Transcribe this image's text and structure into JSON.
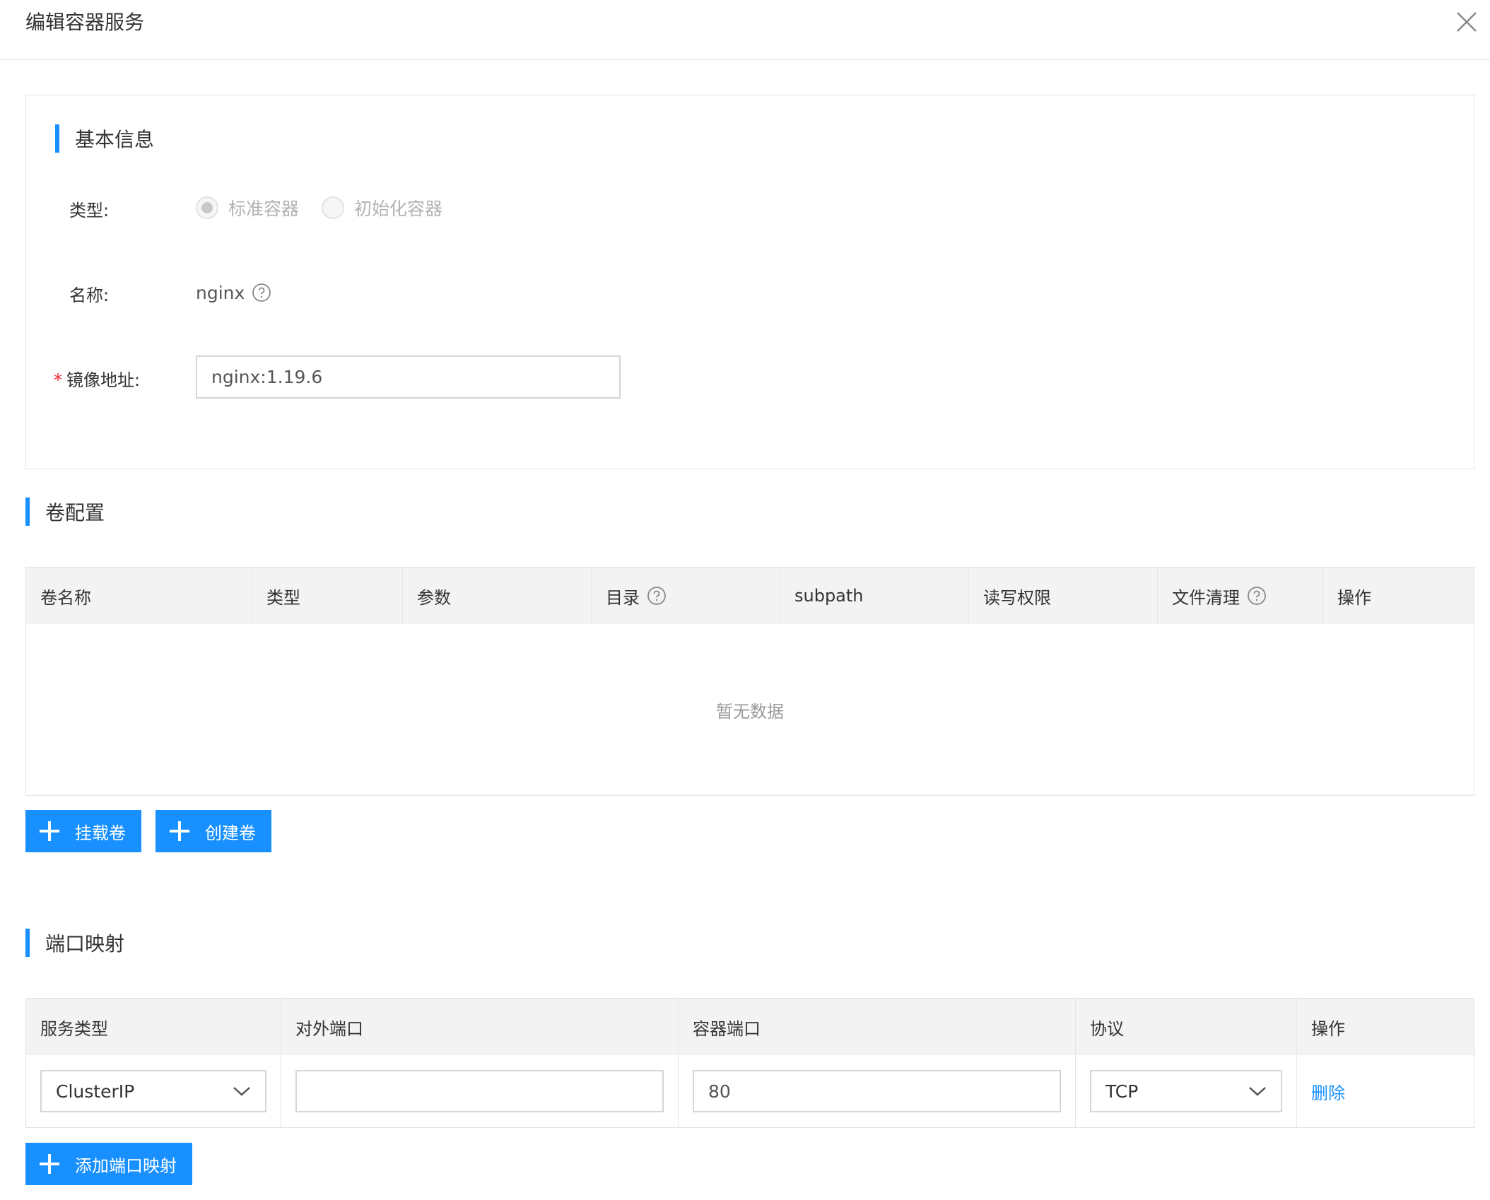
{
  "dialog": {
    "title": "编辑容器服务"
  },
  "basic": {
    "section_title": "基本信息",
    "type_label": "类型:",
    "type_options": [
      "标准容器",
      "初始化容器"
    ],
    "name_label": "名称:",
    "name_value": "nginx",
    "image_label": "镜像地址:",
    "image_value": "nginx:1.19.6"
  },
  "volume": {
    "section_title": "卷配置",
    "columns": [
      "卷名称",
      "类型",
      "参数",
      "目录",
      "subpath",
      "读写权限",
      "文件清理",
      "操作"
    ],
    "empty_text": "暂无数据",
    "mount_button": "挂载卷",
    "create_button": "创建卷"
  },
  "ports": {
    "section_title": "端口映射",
    "columns": [
      "服务类型",
      "对外端口",
      "容器端口",
      "协议",
      "操作"
    ],
    "row": {
      "service_type": "ClusterIP",
      "external_port": "",
      "container_port": "80",
      "protocol": "TCP",
      "action": "删除"
    },
    "add_button": "添加端口映射"
  },
  "colors": {
    "accent": "#1890ff",
    "required": "#f5222d"
  }
}
